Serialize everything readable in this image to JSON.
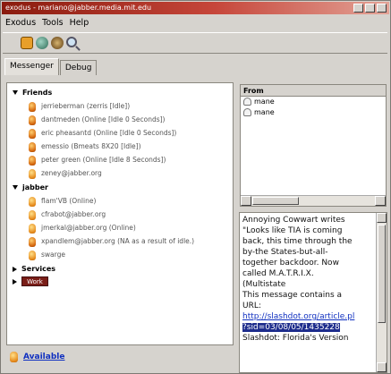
{
  "window": {
    "title": "exodus - mariano@jabber.media.mit.edu"
  },
  "menu": [
    "Exodus",
    "Tools",
    "Help"
  ],
  "toolbar": {
    "icons": [
      "contacts-icon",
      "globe-icon",
      "bear-icon",
      "search-icon"
    ]
  },
  "tabs": [
    {
      "label": "Messenger",
      "active": true
    },
    {
      "label": "Debug",
      "active": false
    }
  ],
  "roster": {
    "groups": [
      {
        "name": "Friends",
        "expanded": true,
        "contacts": [
          {
            "label": "jerrieberman (zerris [Idle])",
            "status": "away"
          },
          {
            "label": "dantmeden (Online [Idle 0 Seconds])",
            "status": "away"
          },
          {
            "label": "eric pheasantd (Online [Idle 0 Seconds])",
            "status": "away"
          },
          {
            "label": "emessio (Bmeats 8X20 [Idle])",
            "status": "away"
          },
          {
            "label": "peter green (Online [Idle 8 Seconds])",
            "status": "away"
          },
          {
            "label": "zeney@jabber.org",
            "status": "offline"
          }
        ]
      },
      {
        "name": "jabber",
        "expanded": true,
        "contacts": [
          {
            "label": "flam'VB (Online)",
            "status": "online"
          },
          {
            "label": "cfrabot@jabber.org",
            "status": "online"
          },
          {
            "label": "jmerkal@jabber.org (Online)",
            "status": "online"
          },
          {
            "label": "xpandlem@jabber.org (NA as a result of idle.)",
            "status": "away"
          },
          {
            "label": "swarge",
            "status": "online"
          }
        ]
      },
      {
        "name": "Services",
        "expanded": false,
        "contacts": []
      },
      {
        "name": "Work",
        "expanded": false,
        "badge": true,
        "contacts": []
      }
    ]
  },
  "from_panel": {
    "header": "From",
    "items": [
      "mane",
      "mane"
    ]
  },
  "message": {
    "lines": [
      "Annoying Cowwart writes",
      "\"Looks like TIA is coming",
      "back, this time through the",
      "by-the States-but-all-",
      "together backdoor. Now",
      "called M.A.T.R.I.X.",
      "(Multistate"
    ],
    "note_lines": [
      "This message contains a",
      "URL:"
    ],
    "link_line1": "http://slashdot.org/article.pl",
    "link_line2": "?sid=03/08/05/1435228",
    "footer": "Slashdot: Florida's Version"
  },
  "status": {
    "label": "Available"
  }
}
